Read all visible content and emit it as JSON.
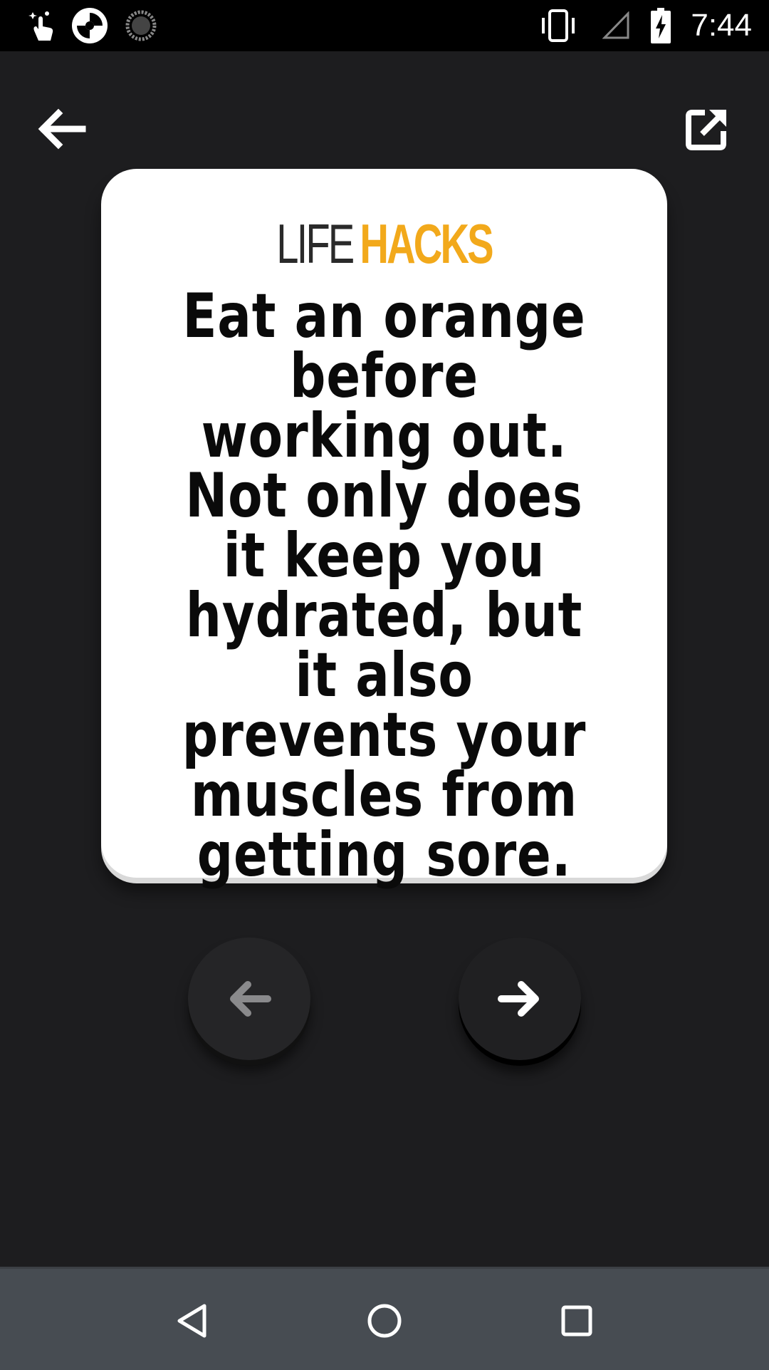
{
  "status_bar": {
    "time": "7:44",
    "left_icons": [
      "touch-sparkle-icon",
      "aperture-app-icon",
      "loading-spinner-icon"
    ],
    "right_icons": [
      "vibrate-icon",
      "no-signal-icon",
      "battery-charging-icon"
    ]
  },
  "toolbar": {
    "back_icon": "arrow-left-icon",
    "share_icon": "share-external-icon"
  },
  "card": {
    "brand_life": "LIFE",
    "brand_hacks": "HACKS",
    "hack_text": "Eat an orange before working out. Not only does it keep you hydrated, but it also prevents your muscles from getting sore."
  },
  "navigation": {
    "previous_icon": "arrow-left-icon",
    "next_icon": "arrow-right-icon"
  },
  "colors": {
    "background": "#1d1d1f",
    "card": "#ffffff",
    "brand_accent": "#f2a91b",
    "system_nav": "#474c52"
  }
}
